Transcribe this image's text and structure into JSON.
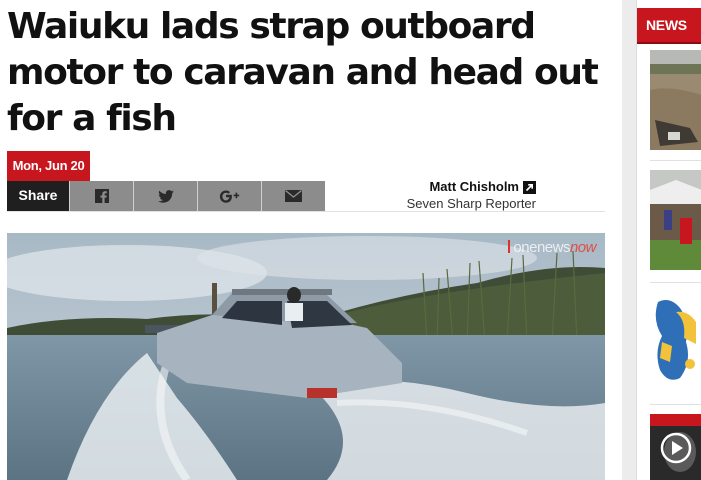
{
  "article": {
    "headline_lines": [
      "Waiuku lads strap outboard",
      "motor to caravan and head out",
      "for a fish"
    ],
    "date": "Mon, Jun 20",
    "share": {
      "label": "Share",
      "buttons": [
        {
          "icon": "facebook-icon"
        },
        {
          "icon": "twitter-icon"
        },
        {
          "icon": "google-plus-icon"
        },
        {
          "icon": "email-icon"
        }
      ]
    },
    "author": {
      "name": "Matt Chisholm",
      "role": "Seven Sharp Reporter",
      "link_icon": "external-link-icon"
    },
    "hero": {
      "watermark_one": "one",
      "watermark_news": "news",
      "watermark_now": "now"
    }
  },
  "sidebar": {
    "header": "NEWS",
    "accent_color": "#c8161e",
    "thumbnails": [
      "flood-scene",
      "outdoor-event",
      "map-graphic",
      "video-thumbnail"
    ]
  },
  "colors": {
    "brand_red": "#c8161e",
    "share_label_bg": "#1f1f1f",
    "share_button_bg": "#8c8c8c"
  }
}
